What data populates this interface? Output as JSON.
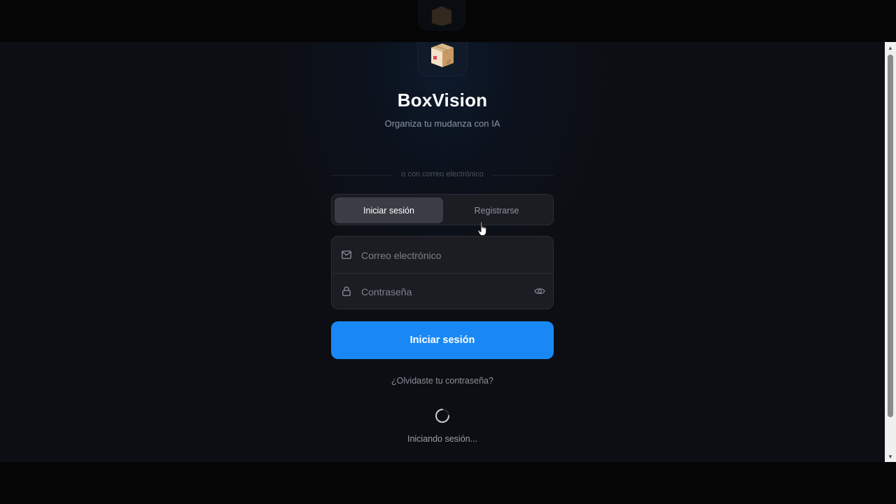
{
  "app": {
    "title": "BoxVision",
    "subtitle": "Organiza tu mudanza con IA"
  },
  "divider": {
    "label": "o con correo electrónico"
  },
  "tabs": [
    {
      "label": "Iniciar sesión",
      "active": true
    },
    {
      "label": "Registrarse",
      "active": false
    }
  ],
  "form": {
    "email": {
      "placeholder": "Correo electrónico",
      "value": "",
      "icon": "mail-icon"
    },
    "password": {
      "placeholder": "Contraseña",
      "value": "",
      "icon": "lock-icon",
      "toggle_icon": "eye-icon"
    },
    "submit_label": "Iniciar sesión",
    "forgot_label": "¿Olvidaste tu contraseña?"
  },
  "status": {
    "loading_text": "Iniciando sesión..."
  },
  "colors": {
    "accent": "#1a88f4",
    "background": "#0d0e13",
    "panel": "#1b1d23"
  }
}
